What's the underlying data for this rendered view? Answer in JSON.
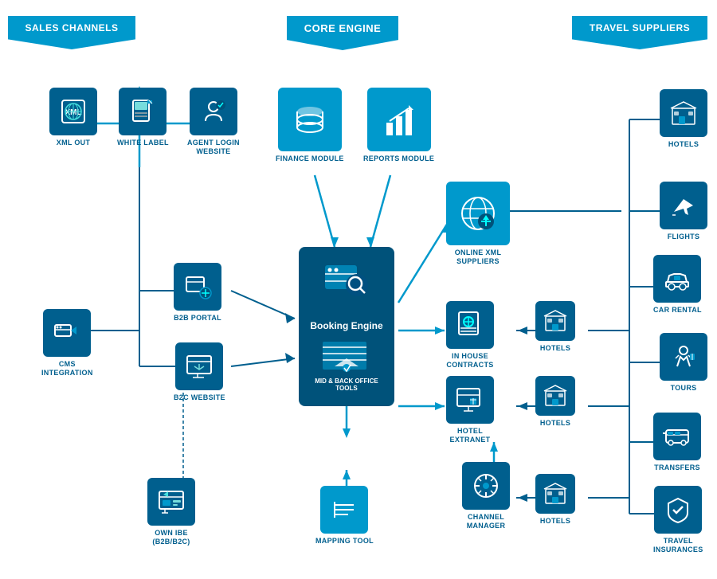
{
  "headers": {
    "sales_channels": "SALES CHANNELS",
    "core_engine": "CORE ENGINE",
    "travel_suppliers": "TRAVEL SUPPLIERS"
  },
  "sales_channels": {
    "xml_out": "XML OUT",
    "white_label": "WHITE LABEL",
    "agent_login_website": "AGENT LOGIN\nWEBSITE",
    "b2b_portal": "B2B PORTAL",
    "b2c_website": "B2C WEBSITE",
    "cms_integration": "CMS\nINTEGRATION",
    "own_ibe": "OWN IBE\n(B2B/B2C)"
  },
  "core_engine": {
    "finance_module": "FINANCE MODULE",
    "reports_module": "REPORTS MODULE",
    "booking_engine": "Booking Engine",
    "mid_back_office": "MID & BACK OFFICE TOOLS",
    "mapping_tool": "MAPPING TOOL"
  },
  "middle": {
    "online_xml_suppliers": "ONLINE XML\nSUPPLIERS",
    "in_house_contracts": "IN HOUSE\nCONTRACTS",
    "hotels_middle1": "HOTELS",
    "hotel_extranet": "HOTEL\nEXTRANET",
    "hotels_middle2": "HOTELS",
    "channel_manager": "CHANNEL\nMANAGER",
    "hotels_middle3": "HOTELS"
  },
  "travel_suppliers": {
    "hotels": "HOTELS",
    "flights": "FLIGHTS",
    "car_rental": "CAR RENTAL",
    "tours": "TOURS",
    "transfers": "TRANSFERS",
    "travel_insurances": "TRAVEL\nINSURANCES"
  }
}
